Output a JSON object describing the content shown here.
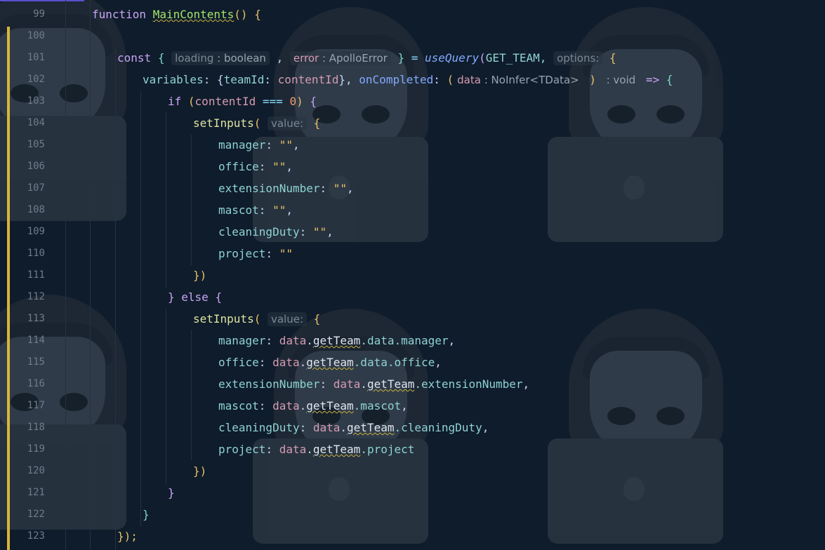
{
  "editor": {
    "line_numbers": [
      "99",
      "100",
      "101",
      "102",
      "103",
      "104",
      "105",
      "106",
      "107",
      "108",
      "109",
      "110",
      "111",
      "112",
      "113",
      "114",
      "115",
      "116",
      "117",
      "118",
      "119",
      "120",
      "121",
      "122",
      "123"
    ],
    "line99": {
      "kw": "function",
      "name": "MainContents",
      "rest": "() {"
    },
    "line101": {
      "kw": "const",
      "open": "{",
      "loading_name": "loading",
      "loading_type": ": boolean",
      "error_name": "error",
      "error_type": ": ApolloError",
      "close": "}",
      "eq": "=",
      "call": "useQuery",
      "arg": "GET_TEAM,",
      "hint_options": "options:",
      "brace": "{"
    },
    "line102": {
      "prop1": "variables",
      "teamId_prop": "teamId",
      "teamId_val": "contentId",
      "prop2": "onCompleted",
      "param": "data",
      "param_type": ": NoInfer<TData>",
      "ret_type": ": void",
      "arrow": "=>",
      "brace": "{"
    },
    "line103": {
      "kw": "if",
      "cond_var": "contentId",
      "cond_op": "===",
      "cond_num": "0",
      "brace": "{"
    },
    "set_inputs": {
      "fn": "setInputs",
      "hint": "value:"
    },
    "empty_block": [
      {
        "key": "manager",
        "val": "\"\""
      },
      {
        "key": "office",
        "val": "\"\""
      },
      {
        "key": "extensionNumber",
        "val": "\"\""
      },
      {
        "key": "mascot",
        "val": "\"\""
      },
      {
        "key": "cleaningDuty",
        "val": "\"\""
      },
      {
        "key": "project",
        "val": "\"\""
      }
    ],
    "line111": "})",
    "line112": {
      "close": "}",
      "kw": "else",
      "open": "{"
    },
    "data_block": [
      {
        "key": "manager",
        "obj": "data",
        "member": "getTeam",
        "rest": ".data.manager"
      },
      {
        "key": "office",
        "obj": "data",
        "member": "getTeam",
        "rest": ".data.office"
      },
      {
        "key": "extensionNumber",
        "obj": "data",
        "member": "getTeam",
        "rest": ".extensionNumber"
      },
      {
        "key": "mascot",
        "obj": "data",
        "member": "getTeam",
        "rest": ".mascot"
      },
      {
        "key": "cleaningDuty",
        "obj": "data",
        "member": "getTeam",
        "rest": ".cleaningDuty"
      },
      {
        "key": "project",
        "obj": "data",
        "member": "getTeam",
        "rest": ".project"
      }
    ],
    "line120": "})",
    "line121": "}",
    "line122": "}",
    "line123": "});"
  },
  "colors": {
    "background": "#0f1c2b",
    "modified_marker": "#d8b53a",
    "keyword": "#c9a4f7",
    "function_def": "#a6e36b",
    "property": "#8ed3d2",
    "string": "#e6c06a"
  }
}
